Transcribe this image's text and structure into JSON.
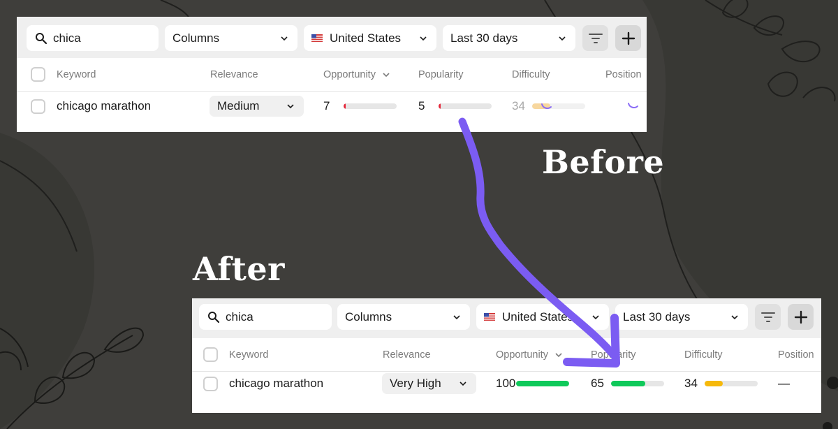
{
  "before": {
    "search": {
      "value": "chica",
      "icon": "search-icon"
    },
    "columns_dropdown": "Columns",
    "country_dropdown": "United States",
    "date_dropdown": "Last 30 days",
    "headers": {
      "keyword": "Keyword",
      "relevance": "Relevance",
      "opportunity": "Opportunity",
      "popularity": "Popularity",
      "difficulty": "Difficulty",
      "position": "Position"
    },
    "row": {
      "keyword": "chicago marathon",
      "relevance": "Medium",
      "opportunity": {
        "value": "7",
        "percent": 2,
        "color": "#e5273a"
      },
      "popularity": {
        "value": "5",
        "percent": 2,
        "color": "#e5273a"
      },
      "difficulty": {
        "value": "34",
        "percent": 34,
        "color": "#f7d79e"
      },
      "position": ""
    }
  },
  "after": {
    "search": {
      "value": "chica",
      "icon": "search-icon"
    },
    "columns_dropdown": "Columns",
    "country_dropdown": "United States",
    "date_dropdown": "Last 30 days",
    "headers": {
      "keyword": "Keyword",
      "relevance": "Relevance",
      "opportunity": "Opportunity",
      "popularity": "Popularity",
      "difficulty": "Difficulty",
      "position": "Position"
    },
    "row": {
      "keyword": "chicago marathon",
      "relevance": "Very High",
      "opportunity": {
        "value": "100",
        "percent": 100,
        "color": "#0fc95a"
      },
      "popularity": {
        "value": "65",
        "percent": 65,
        "color": "#0fc95a"
      },
      "difficulty": {
        "value": "34",
        "percent": 34,
        "color": "#f6b90b"
      },
      "position": "—"
    }
  },
  "labels": {
    "before": "Before",
    "after": "After"
  },
  "colors": {
    "arrow": "#7b5cf2",
    "background": "#3f3e3b",
    "spinner": "#8a6cf6"
  }
}
